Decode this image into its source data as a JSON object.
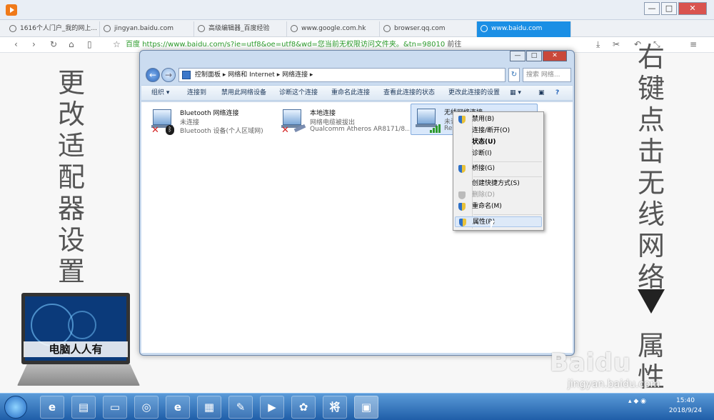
{
  "browser": {
    "tabs": [
      {
        "label": "1616个人门户_我的网上..."
      },
      {
        "label": "jingyan.baidu.com"
      },
      {
        "label": "高级编辑器_百度经验"
      },
      {
        "label": "www.google.com.hk"
      },
      {
        "label": "browser.qq.com"
      },
      {
        "label": "www.baidu.com"
      }
    ],
    "new_tab_label": "+",
    "tab_count": "6",
    "address_prefix": "百度",
    "address_url": "https://www.baidu.com/s?ie=utf8&oe=utf8&wd=您当前无权限访问文件夹。&tn=98010",
    "address_action": "前往",
    "window_controls": {
      "min": "—",
      "max": "□",
      "close": "✕"
    }
  },
  "captions": {
    "left": [
      "更",
      "改",
      "适",
      "配",
      "器",
      "设",
      "置"
    ],
    "right": [
      "右",
      "键",
      "点",
      "击",
      "无",
      "线",
      "网",
      "络"
    ],
    "right_bottom": [
      "属",
      "性"
    ]
  },
  "laptop_label": "电脑人人有",
  "explorer": {
    "breadcrumb": "控制面板 ▸ 网络和 Internet ▸ 网络连接 ▸",
    "search_placeholder": "搜索 网络...",
    "commands": [
      "组织 ▾",
      "连接到",
      "禁用此网络设备",
      "诊断这个连接",
      "重命名此连接",
      "查看此连接的状态",
      "更改此连接的设置"
    ],
    "items": [
      {
        "name": "Bluetooth 网络连接",
        "status": "未连接",
        "device": "Bluetooth 设备(个人区域网)"
      },
      {
        "name": "本地连接",
        "status": "网络电缆被拔出",
        "device": "Qualcomm Atheros AR8171/8..."
      },
      {
        "name": "无线网络连接",
        "status": "未识别",
        "device": "Realt"
      }
    ]
  },
  "context_menu": {
    "items": [
      {
        "label": "禁用(B)"
      },
      {
        "label": "连接/断开(O)"
      },
      {
        "label": "状态(U)"
      },
      {
        "label": "诊断(I)"
      },
      {
        "label": "桥接(G)"
      },
      {
        "label": "创建快捷方式(S)"
      },
      {
        "label": "删除(D)"
      },
      {
        "label": "重命名(M)"
      },
      {
        "label": "属性(R)"
      }
    ]
  },
  "taskbar": {
    "clock_time": "15:40",
    "clock_date": "2018/9/24",
    "special_icon": "将"
  },
  "watermark": {
    "brand": "Baidu",
    "sub": "jingyan.baidu.com"
  }
}
